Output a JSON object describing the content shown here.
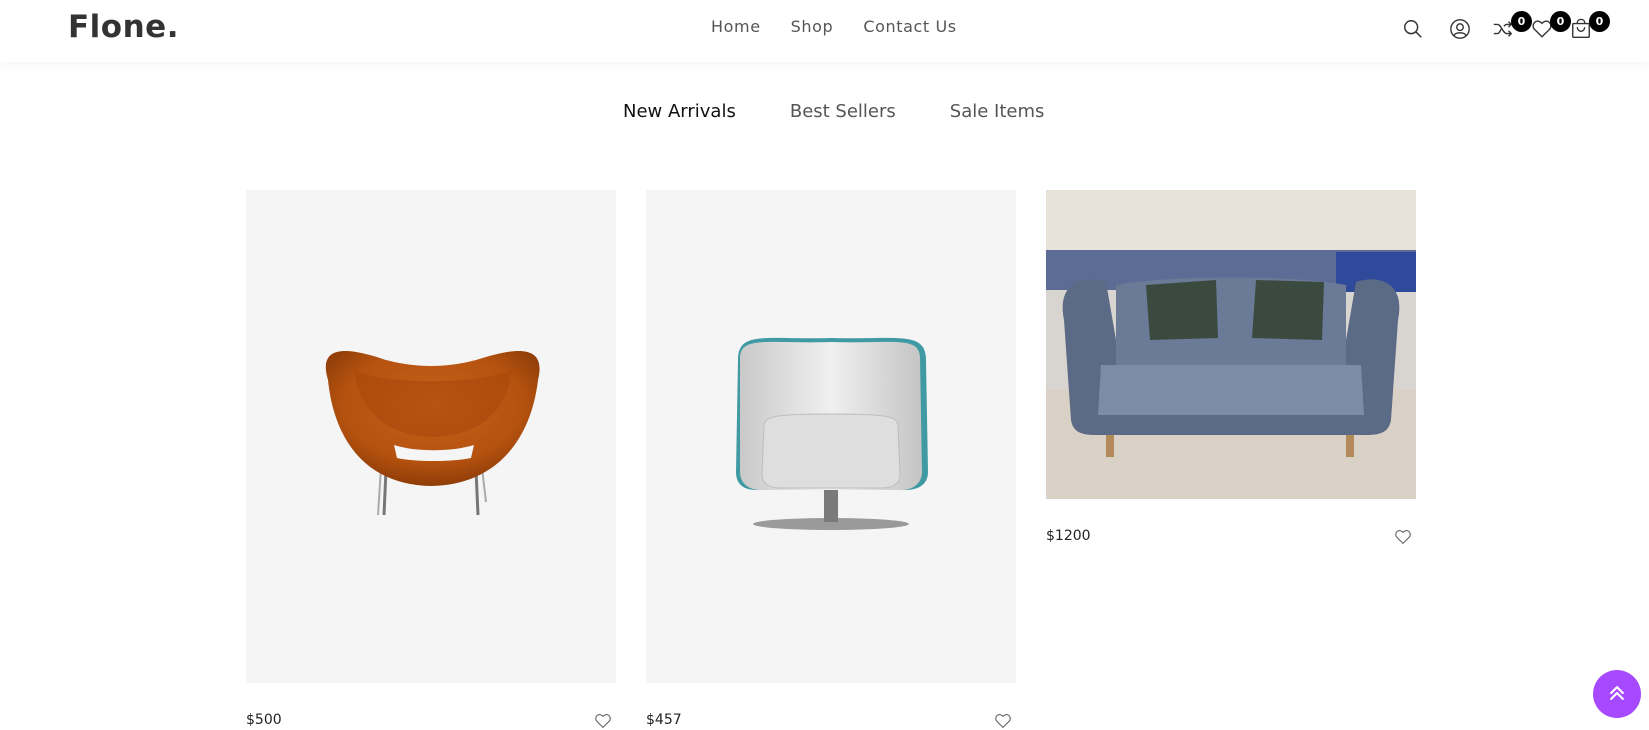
{
  "brand": {
    "logo": "Flone."
  },
  "nav": {
    "items": [
      {
        "label": "Home"
      },
      {
        "label": "Shop"
      },
      {
        "label": "Contact Us"
      }
    ]
  },
  "header_icons": {
    "search": "search-icon",
    "account": "user-icon",
    "compare": {
      "icon": "shuffle-icon",
      "count": "0"
    },
    "wishlist": {
      "icon": "heart-icon",
      "count": "0"
    },
    "cart": {
      "icon": "shopping-bag-icon",
      "count": "0"
    }
  },
  "tabs": [
    {
      "label": "New Arrivals",
      "active": true
    },
    {
      "label": "Best Sellers",
      "active": false
    },
    {
      "label": "Sale Items",
      "active": false
    }
  ],
  "products": [
    {
      "price": "$500",
      "image": "orange-lounge-chair"
    },
    {
      "price": "$457",
      "image": "white-swivel-armchair"
    },
    {
      "price": "$1200",
      "image": "blue-tufted-sofa"
    }
  ],
  "colors": {
    "accent": "#a749ff",
    "badge": "#000000",
    "card_bg": "#f5f5f6"
  },
  "scroll_top": {
    "icon": "double-chevron-up-icon"
  }
}
